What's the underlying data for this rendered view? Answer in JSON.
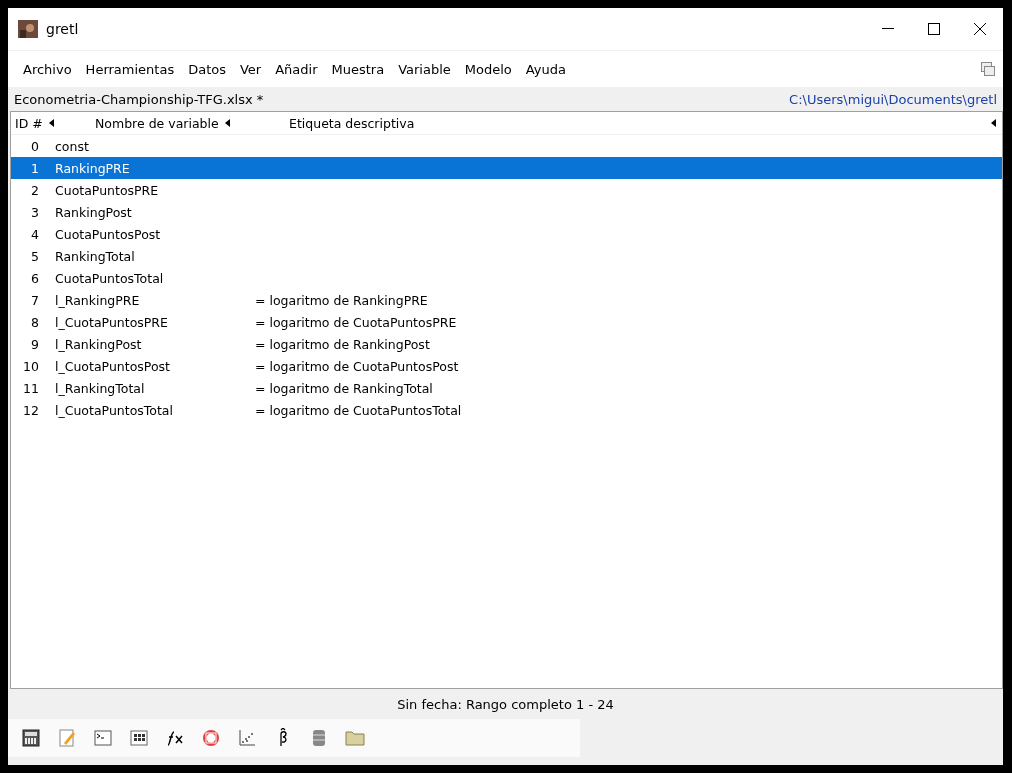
{
  "window": {
    "title": "gretl"
  },
  "menu": [
    "Archivo",
    "Herramientas",
    "Datos",
    "Ver",
    "Añadir",
    "Muestra",
    "Variable",
    "Modelo",
    "Ayuda"
  ],
  "file_bar": {
    "filename": "Econometria-Championship-TFG.xlsx *",
    "path": "C:\\Users\\migui\\Documents\\gretl"
  },
  "table": {
    "columns": [
      "ID #",
      "Nombre de variable",
      "Etiqueta descriptiva"
    ],
    "rows": [
      {
        "id": "0",
        "name": "const",
        "label": "",
        "selected": false
      },
      {
        "id": "1",
        "name": "RankingPRE",
        "label": "",
        "selected": true
      },
      {
        "id": "2",
        "name": "CuotaPuntosPRE",
        "label": "",
        "selected": false
      },
      {
        "id": "3",
        "name": "RankingPost",
        "label": "",
        "selected": false
      },
      {
        "id": "4",
        "name": "CuotaPuntosPost",
        "label": "",
        "selected": false
      },
      {
        "id": "5",
        "name": "RankingTotal",
        "label": "",
        "selected": false
      },
      {
        "id": "6",
        "name": "CuotaPuntosTotal",
        "label": "",
        "selected": false
      },
      {
        "id": "7",
        "name": "l_RankingPRE",
        "label": "= logaritmo de RankingPRE",
        "selected": false
      },
      {
        "id": "8",
        "name": "l_CuotaPuntosPRE",
        "label": "= logaritmo de CuotaPuntosPRE",
        "selected": false
      },
      {
        "id": "9",
        "name": "l_RankingPost",
        "label": "= logaritmo de RankingPost",
        "selected": false
      },
      {
        "id": "10",
        "name": "l_CuotaPuntosPost",
        "label": "= logaritmo de CuotaPuntosPost",
        "selected": false
      },
      {
        "id": "11",
        "name": "l_RankingTotal",
        "label": "= logaritmo de RankingTotal",
        "selected": false
      },
      {
        "id": "12",
        "name": "l_CuotaPuntosTotal",
        "label": "= logaritmo de CuotaPuntosTotal",
        "selected": false
      }
    ]
  },
  "status_bar": "Sin fecha: Rango completo 1 - 24",
  "toolbar": [
    {
      "kind": "calculator"
    },
    {
      "kind": "editor"
    },
    {
      "kind": "console"
    },
    {
      "kind": "session"
    },
    {
      "kind": "function"
    },
    {
      "kind": "help"
    },
    {
      "kind": "plot"
    },
    {
      "kind": "beta"
    },
    {
      "kind": "database"
    },
    {
      "kind": "folder"
    }
  ]
}
